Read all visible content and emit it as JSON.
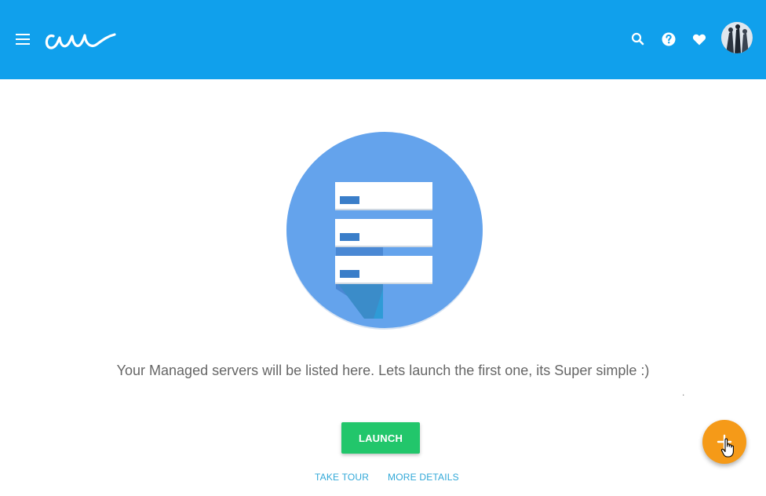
{
  "header": {
    "background": "#10a0ec",
    "menu_icon": "hamburger-menu-icon",
    "logo_icon": "cloudways-logo",
    "actions": [
      {
        "name": "search",
        "icon": "search-icon"
      },
      {
        "name": "help",
        "icon": "help-icon"
      },
      {
        "name": "favorites",
        "icon": "heart-icon"
      }
    ],
    "avatar_icon": "user-avatar"
  },
  "main": {
    "illustration_icon": "server-stack-illustration",
    "empty_message": "Your Managed servers will be listed here. Lets launch the first one, its Super simple :)",
    "stray_mark": ".",
    "launch_label": "LAUNCH",
    "take_tour_label": "TAKE TOUR",
    "more_details_label": "MORE DETAILS"
  },
  "fab": {
    "icon": "plus-icon",
    "color": "#f59a18"
  },
  "colors": {
    "launch": "#22c66b",
    "link": "#31a8d8",
    "illustration_circle": "#64a3ec"
  }
}
